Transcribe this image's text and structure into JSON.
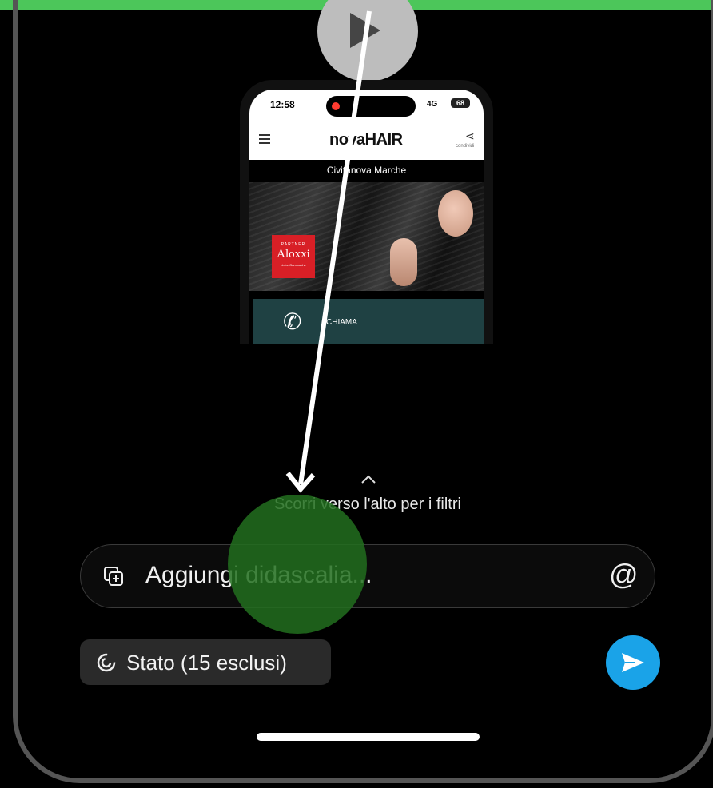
{
  "phone_preview": {
    "time": "12:58",
    "network": "4G",
    "battery": "68",
    "brand": "novaHAIR",
    "share_label": "condividi",
    "city": "Civitanova Marche",
    "logo_text": {
      "partner": "PARTNER",
      "name": "Aloxxi",
      "sub": "Liebe Gammache"
    },
    "call_label": "CHIAMA"
  },
  "filters_hint": "Scorri verso l'alto per i filtri",
  "caption": {
    "placeholder": "Aggiungi didascalia..."
  },
  "status_chip": {
    "label": "Stato (15 esclusi)"
  },
  "icons": [
    "play-icon",
    "menu-icon",
    "share-icon",
    "phone-icon",
    "chevron-up-icon",
    "add-media-icon",
    "mention-icon",
    "status-icon",
    "send-icon"
  ],
  "colors": {
    "top_bar": "#4cc65a",
    "send_button": "#1aa3e8",
    "touch_indicator": "#226e1e"
  }
}
